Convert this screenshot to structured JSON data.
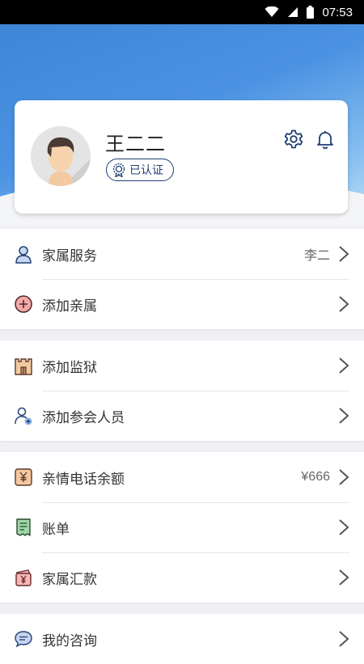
{
  "status_bar": {
    "time": "07:53"
  },
  "profile": {
    "name": "王二二",
    "verified_label": "已认证"
  },
  "sections": [
    {
      "items": [
        {
          "label": "家属服务",
          "value": "李二"
        },
        {
          "label": "添加亲属"
        }
      ]
    },
    {
      "items": [
        {
          "label": "添加监狱"
        },
        {
          "label": "添加参会人员"
        }
      ]
    },
    {
      "items": [
        {
          "label": "亲情电话余额",
          "value": "¥666"
        },
        {
          "label": "账单"
        },
        {
          "label": "家属汇款"
        }
      ]
    },
    {
      "items": [
        {
          "label": "我的咨询"
        }
      ]
    }
  ],
  "colors": {
    "accent": "#1f3f73",
    "hero_start": "#3d86d6",
    "hero_end": "#bfe0fa"
  }
}
